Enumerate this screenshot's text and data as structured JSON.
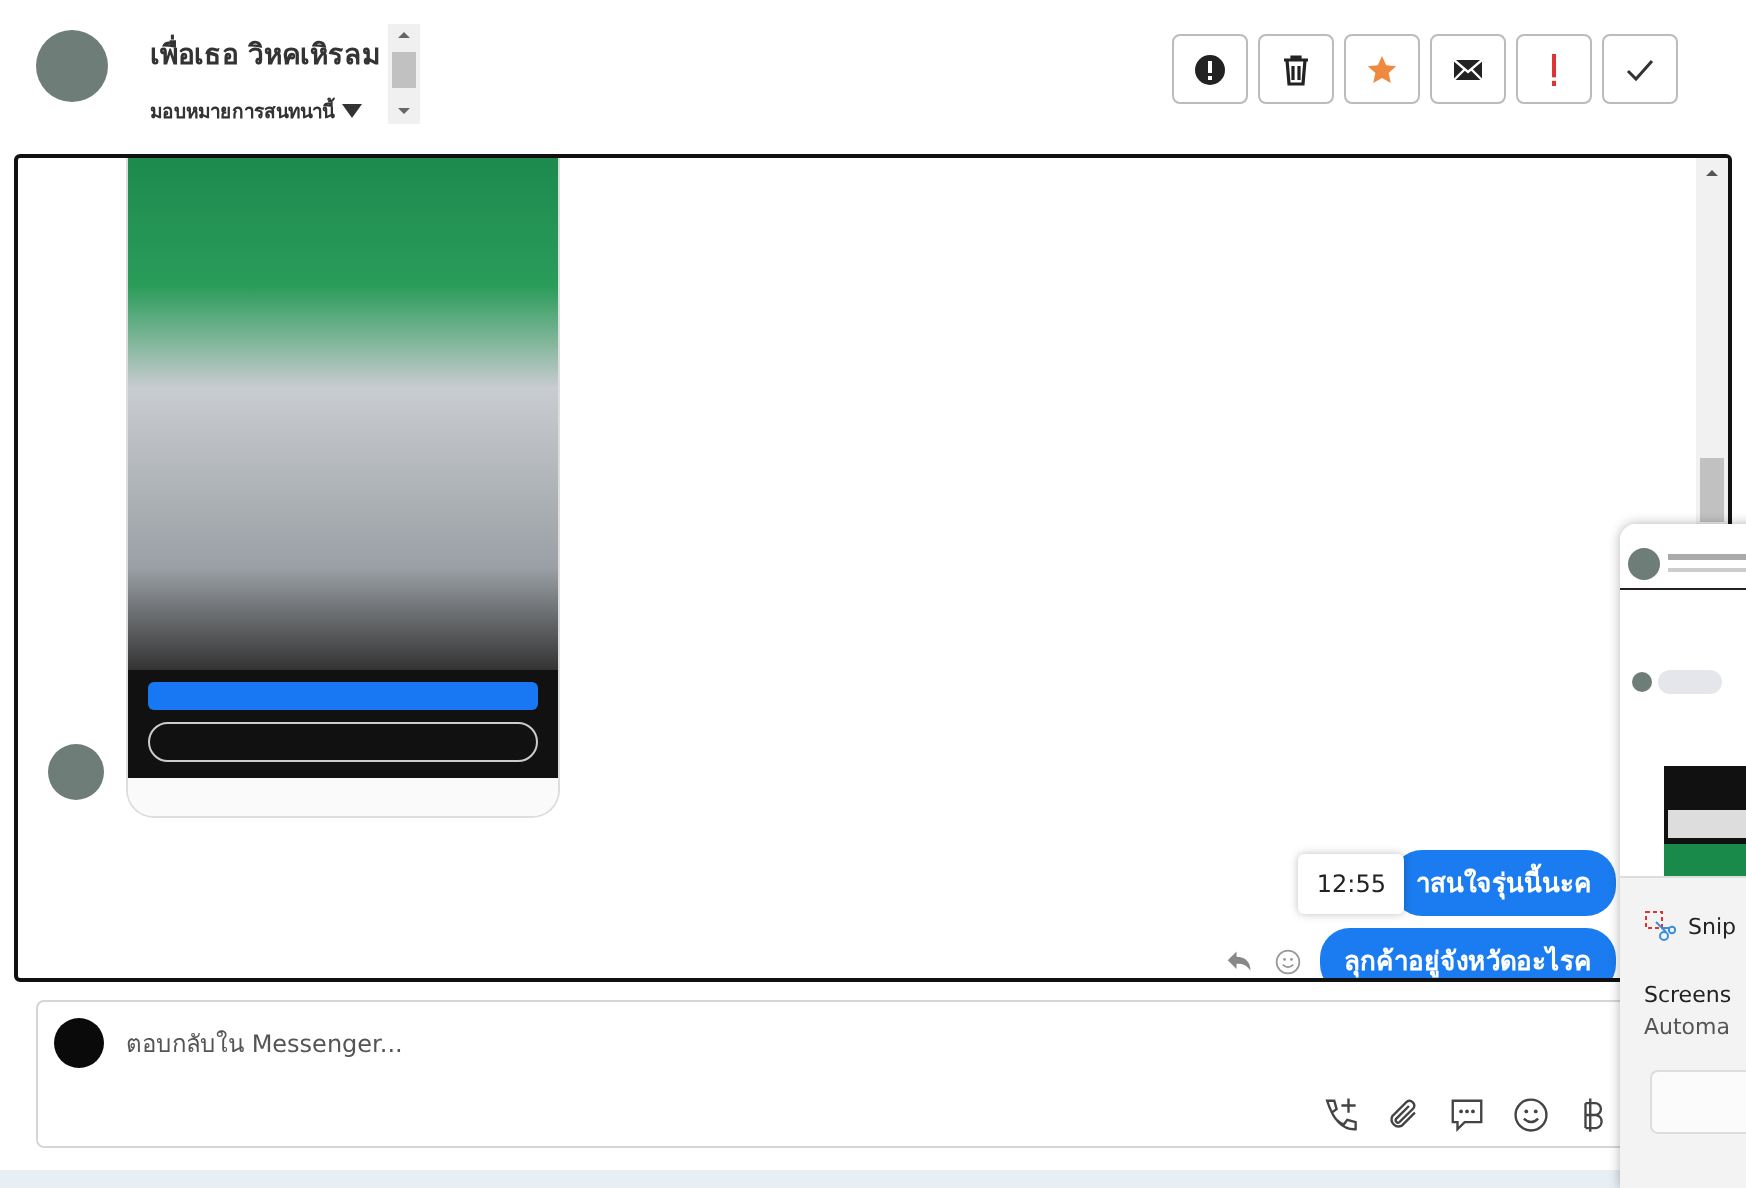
{
  "contact": {
    "name": "เพื่อเธอ วิหคเหิรลม",
    "assign_label": "มอบหมายการสนทนานี้"
  },
  "actions": [
    {
      "kind": "alert"
    },
    {
      "kind": "delete"
    },
    {
      "kind": "star",
      "on": true
    },
    {
      "kind": "mail"
    },
    {
      "kind": "important"
    },
    {
      "kind": "done"
    }
  ],
  "messages": [
    {
      "kind": "image"
    },
    {
      "kind": "text",
      "text": "าสนใจรุ่นนี้นะค",
      "time": "12:55"
    },
    {
      "kind": "text",
      "text": "ลุกค้าอยู่จังหวัดอะไรค"
    }
  ],
  "composer": {
    "placeholder": "ตอบกลับใน Messenger..."
  },
  "notification": {
    "app": "Snip",
    "title": "Screens",
    "body": "Automa"
  }
}
